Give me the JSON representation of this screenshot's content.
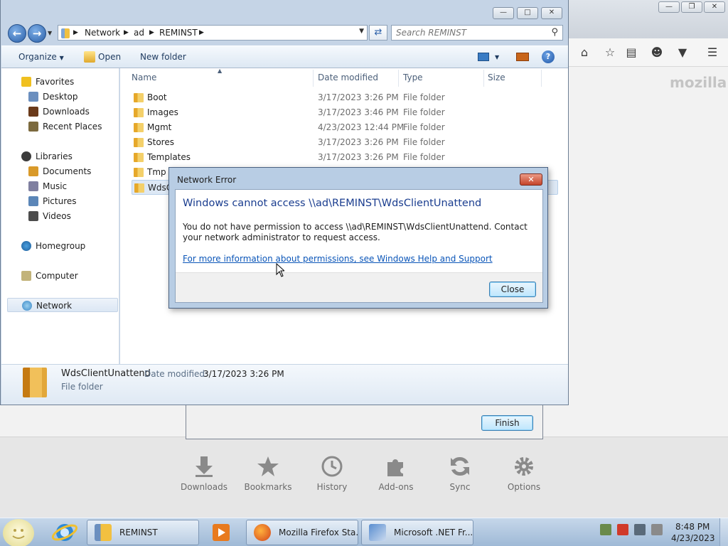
{
  "explorer": {
    "breadcrumb": [
      "Network",
      "ad",
      "REMINST"
    ],
    "search_placeholder": "Search REMINST",
    "commands": {
      "organize": "Organize",
      "open": "Open",
      "new_folder": "New folder"
    },
    "nav": {
      "favorites": "Favorites",
      "desktop": "Desktop",
      "downloads": "Downloads",
      "recent_places": "Recent Places",
      "libraries": "Libraries",
      "documents": "Documents",
      "music": "Music",
      "pictures": "Pictures",
      "videos": "Videos",
      "homegroup": "Homegroup",
      "computer": "Computer",
      "network": "Network"
    },
    "columns": {
      "name": "Name",
      "date": "Date modified",
      "type": "Type",
      "size": "Size"
    },
    "files": [
      {
        "name": "Boot",
        "date": "3/17/2023 3:26 PM",
        "type": "File folder"
      },
      {
        "name": "Images",
        "date": "3/17/2023 3:46 PM",
        "type": "File folder"
      },
      {
        "name": "Mgmt",
        "date": "4/23/2023 12:44 PM",
        "type": "File folder"
      },
      {
        "name": "Stores",
        "date": "3/17/2023 3:26 PM",
        "type": "File folder"
      },
      {
        "name": "Templates",
        "date": "3/17/2023 3:26 PM",
        "type": "File folder"
      },
      {
        "name": "Tmp",
        "date": "",
        "type": ""
      },
      {
        "name": "WdsC",
        "date": "",
        "type": ""
      }
    ],
    "details": {
      "name": "WdsClientUnattend",
      "modified_label": "Date modified:",
      "modified_value": "3/17/2023 3:26 PM",
      "type": "File folder"
    }
  },
  "dialog": {
    "title": "Network Error",
    "heading": "Windows cannot access \\\\ad\\REMINST\\WdsClientUnattend",
    "message": "You do not have permission to access \\\\ad\\REMINST\\WdsClientUnattend. Contact your network administrator to request access.",
    "link": "For more information about permissions, see Windows Help and Support",
    "close_button": "Close"
  },
  "wizard": {
    "finish_button": "Finish"
  },
  "firefox": {
    "brand": "mozilla",
    "launchers": [
      "Downloads",
      "Bookmarks",
      "History",
      "Add-ons",
      "Sync",
      "Options"
    ]
  },
  "taskbar": {
    "buttons": [
      "REMINST",
      "Mozilla Firefox Sta...",
      "Microsoft .NET Fr..."
    ],
    "time": "8:48 PM",
    "date": "4/23/2023"
  },
  "colors": {
    "dialog_heading": "#1a3d8f",
    "link": "#0a55b8",
    "folder": "#e6a82a"
  }
}
